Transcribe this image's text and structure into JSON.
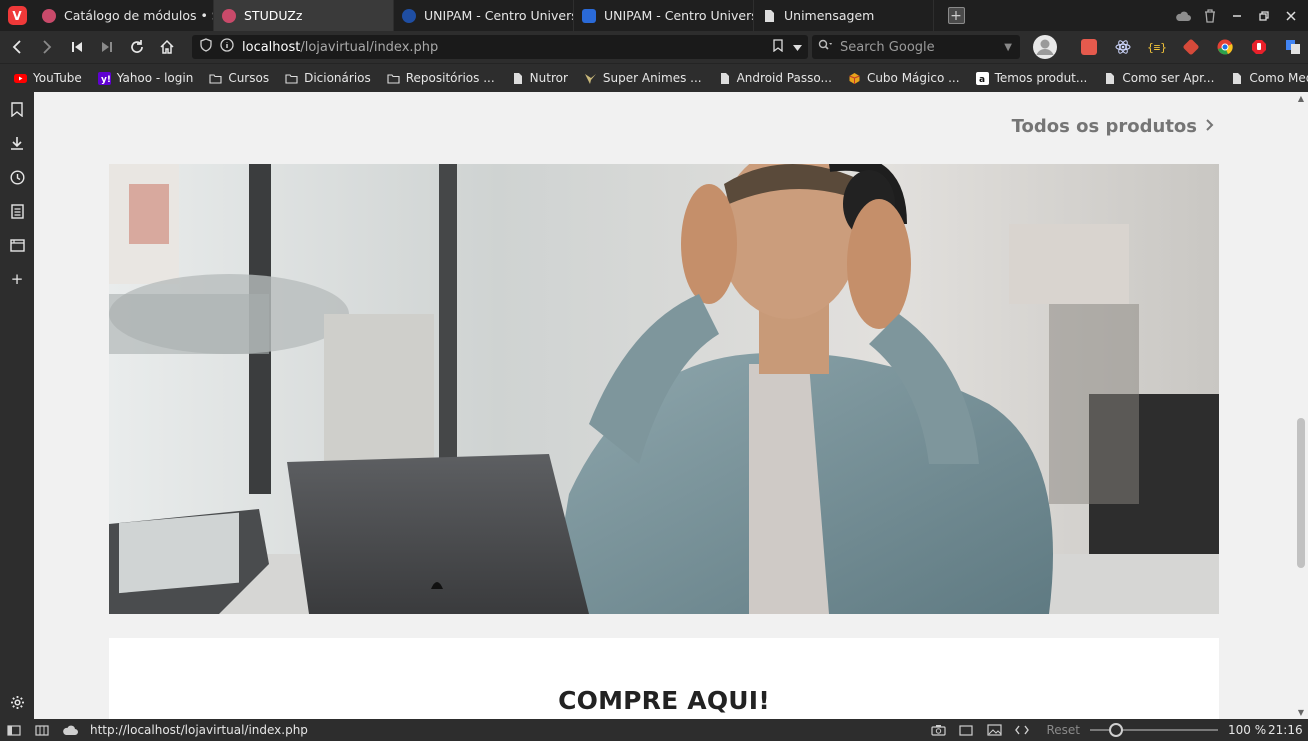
{
  "tabs": [
    {
      "label": "Catálogo de módulos • STUDUZz",
      "active": false,
      "favicon": "studuzz-favicon",
      "color": "#c94a6a"
    },
    {
      "label": "STUDUZz",
      "active": true,
      "favicon": "studuzz-favicon",
      "color": "#c94a6a"
    },
    {
      "label": "UNIPAM - Centro Universitário",
      "active": false,
      "favicon": "unipam-favicon",
      "color": "#1f4ea3"
    },
    {
      "label": "UNIPAM - Centro Universitário",
      "active": false,
      "favicon": "unipam-favicon",
      "color": "#2a6ad8"
    },
    {
      "label": "Unimensagem",
      "active": false,
      "favicon": "page-icon",
      "color": "#dddddd"
    }
  ],
  "address": {
    "host": "localhost",
    "path": "/lojavirtual/index.php",
    "search_placeholder": "Search Google"
  },
  "bookmarks": [
    {
      "label": "YouTube",
      "icon": "youtube-icon"
    },
    {
      "label": "Yahoo - login",
      "icon": "yahoo-icon"
    },
    {
      "label": "Cursos",
      "icon": "folder-icon"
    },
    {
      "label": "Dicionários",
      "icon": "folder-icon"
    },
    {
      "label": "Repositórios ...",
      "icon": "folder-icon"
    },
    {
      "label": "Nutror",
      "icon": "page-icon"
    },
    {
      "label": "Super Animes ...",
      "icon": "animes-icon"
    },
    {
      "label": "Android Passo...",
      "icon": "page-icon"
    },
    {
      "label": "Cubo Mágico ...",
      "icon": "cube-icon"
    },
    {
      "label": "Temos produt...",
      "icon": "amazon-icon"
    },
    {
      "label": "Como ser Apr...",
      "icon": "page-icon"
    },
    {
      "label": "Como Meditar...",
      "icon": "page-icon"
    }
  ],
  "page": {
    "all_products_label": "Todos os produtos",
    "cta_title": "COMPRE AQUI!"
  },
  "statusbar": {
    "url": "http://localhost/lojavirtual/index.php",
    "reset_label": "Reset",
    "zoom": "100 %",
    "time": "21:16",
    "zoom_level": 1.0
  },
  "colors": {
    "vivaldi_red": "#ef3939",
    "page_background": "#f1f1f1",
    "link_gray": "#757575"
  }
}
